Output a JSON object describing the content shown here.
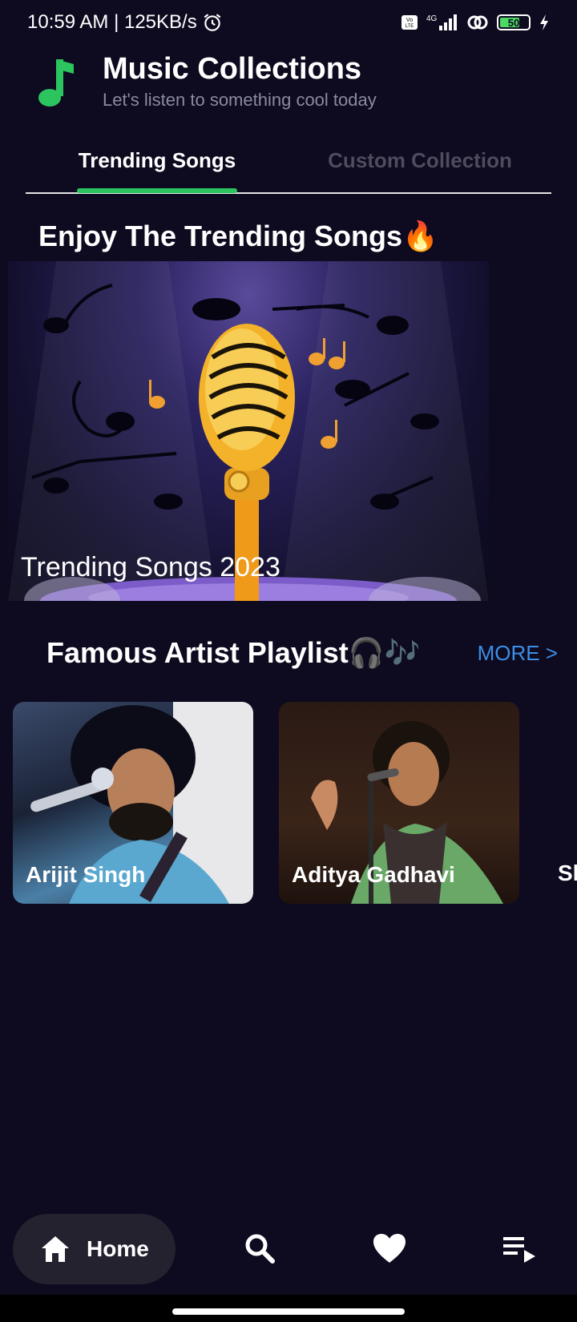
{
  "status_bar": {
    "time_speed": "10:59 AM | 125KB/s",
    "network": "4G",
    "battery": "50"
  },
  "header": {
    "title": "Music Collections",
    "subtitle": "Let's listen to something cool today"
  },
  "tabs": [
    {
      "label": "Trending Songs",
      "active": true
    },
    {
      "label": "Custom Collection",
      "active": false
    }
  ],
  "trending": {
    "section_title": "Enjoy The Trending Songs🔥",
    "banner_caption": "Trending Songs 2023"
  },
  "artists": {
    "section_title": "Famous Artist Playlist🎧🎶",
    "more_label": "MORE >",
    "cards": [
      {
        "name": "Arijit Singh"
      },
      {
        "name": "Aditya Gadhavi"
      },
      {
        "name": "Sh"
      }
    ]
  },
  "bottom_nav": {
    "home_label": "Home",
    "items": [
      "home-icon",
      "search-icon",
      "heart-icon",
      "playlist-icon"
    ]
  },
  "colors": {
    "background": "#0e0a1f",
    "accent_green": "#2cc45f",
    "link_blue": "#3b8fe6"
  }
}
